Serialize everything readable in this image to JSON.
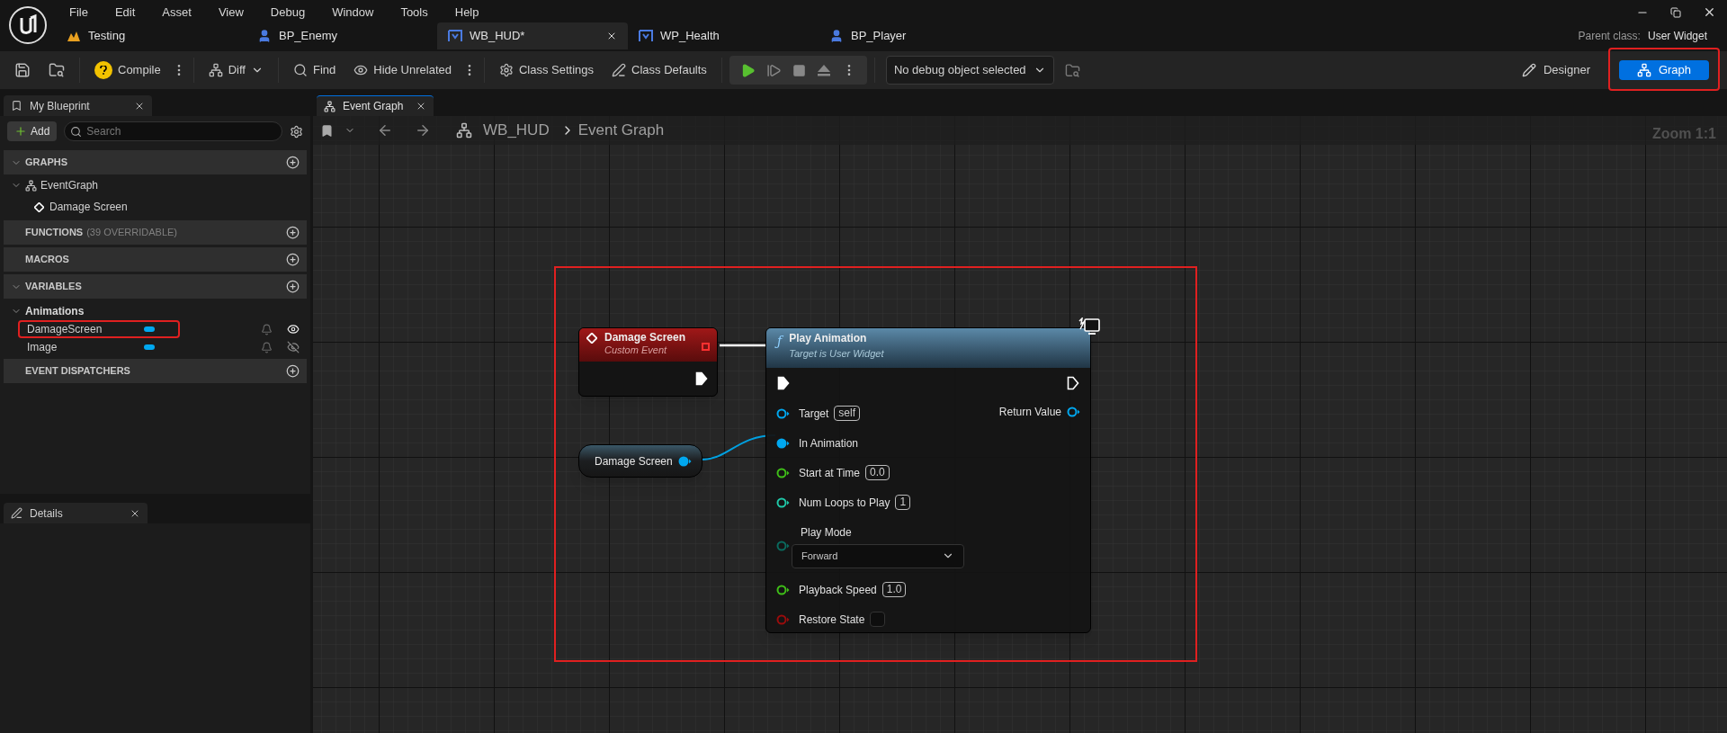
{
  "menu": [
    "File",
    "Edit",
    "Asset",
    "View",
    "Debug",
    "Window",
    "Tools",
    "Help"
  ],
  "tabs": [
    {
      "label": "Testing",
      "kind": "level",
      "selected": false
    },
    {
      "label": "BP_Enemy",
      "kind": "blueprint",
      "selected": false
    },
    {
      "label": "WB_HUD*",
      "kind": "widget",
      "selected": true
    },
    {
      "label": "WP_Health",
      "kind": "widget",
      "selected": false
    },
    {
      "label": "BP_Player",
      "kind": "blueprint",
      "selected": false
    }
  ],
  "parent_class": {
    "label": "Parent class:",
    "value": "User Widget"
  },
  "toolbar": {
    "compile": "Compile",
    "diff": "Diff",
    "find": "Find",
    "hide_unrelated": "Hide Unrelated",
    "class_settings": "Class Settings",
    "class_defaults": "Class Defaults",
    "debug_select": "No debug object selected",
    "modes": [
      {
        "label": "Designer",
        "kind": "designer",
        "selected": false,
        "annotated": false
      },
      {
        "label": "Graph",
        "kind": "graph",
        "selected": true,
        "annotated": true
      }
    ]
  },
  "my_blueprint": {
    "tab": "My Blueprint",
    "add": "Add",
    "search_placeholder": "Search",
    "sections": [
      {
        "title": "GRAPHS",
        "expanded": true,
        "items": [
          {
            "label": "EventGraph",
            "kind": "graph",
            "children": [
              {
                "label": "Damage Screen",
                "kind": "event"
              }
            ]
          }
        ]
      },
      {
        "title": "FUNCTIONS",
        "note": "(39 OVERRIDABLE)"
      },
      {
        "title": "MACROS"
      },
      {
        "title": "VARIABLES",
        "expanded": true,
        "categories": [
          {
            "label": "Animations",
            "expanded": true,
            "variables": [
              {
                "name": "DamageScreen",
                "color": "#00a8f0",
                "visible": true,
                "annotated": true
              },
              {
                "name": "Image",
                "color": "#00a8f0",
                "visible": false,
                "annotated": false
              }
            ]
          }
        ]
      },
      {
        "title": "EVENT DISPATCHERS"
      }
    ]
  },
  "details": {
    "tab": "Details"
  },
  "graph": {
    "tab": "Event Graph",
    "breadcrumb": [
      "WB_HUD",
      "Event Graph"
    ],
    "zoom": "Zoom 1:1",
    "annotation_frame": true,
    "event_node": {
      "title": "Damage Screen",
      "subtitle": "Custom Event"
    },
    "variable_node": {
      "label": "Damage Screen",
      "color": "#00a8f0"
    },
    "function_node": {
      "icon": "ƒ",
      "title": "Play Animation",
      "subtitle": "Target is User Widget",
      "output": {
        "label": "Return Value",
        "color": "#00a8f0"
      },
      "inputs": [
        {
          "label": "Target",
          "kind": "field",
          "value": "self",
          "color": "#00a8f0",
          "connected": false
        },
        {
          "label": "In Animation",
          "kind": "plain",
          "color": "#00a8f0",
          "connected": true
        },
        {
          "label": "Start at Time",
          "kind": "field",
          "value": "0.0",
          "color": "#3fbf18",
          "connected": false
        },
        {
          "label": "Num Loops to Play",
          "kind": "field",
          "value": "1",
          "color": "#1fc8a8",
          "connected": false
        },
        {
          "label": "Play Mode",
          "kind": "enum",
          "value": "Forward",
          "color": "#0a6a5e",
          "connected": false
        },
        {
          "label": "Playback Speed",
          "kind": "field",
          "value": "1.0",
          "color": "#3fbf18",
          "connected": false
        },
        {
          "label": "Restore State",
          "kind": "bool",
          "checked": false,
          "color": "#9a0c0c",
          "connected": false
        }
      ]
    }
  }
}
